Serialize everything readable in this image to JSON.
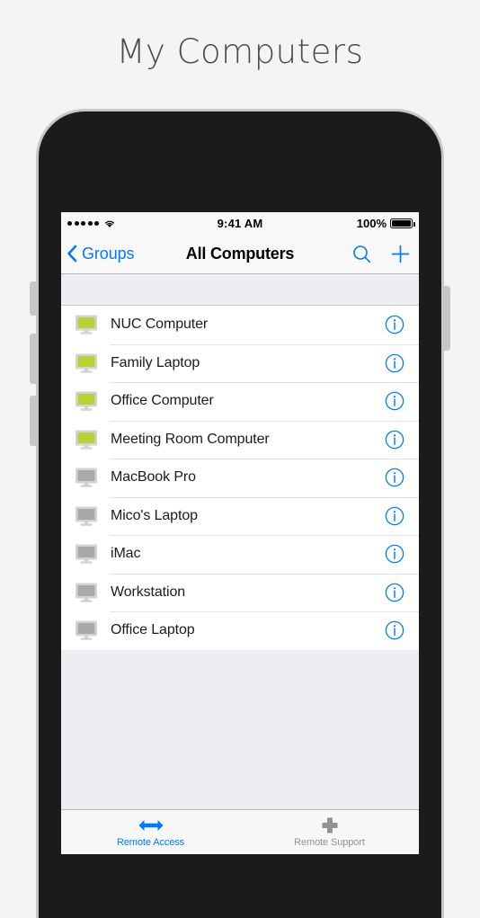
{
  "page": {
    "title": "My Computers"
  },
  "device": {
    "frame_color": "#c7c7c9",
    "body_color": "#1b1b1b"
  },
  "status_bar": {
    "signal_dots": 5,
    "wifi_icon": "wifi-icon",
    "time": "9:41 AM",
    "battery_percent": "100%",
    "battery_icon": "battery-full-icon"
  },
  "nav_bar": {
    "back_label": "Groups",
    "back_icon": "chevron-left-icon",
    "title": "All Computers",
    "search_icon": "search-icon",
    "add_icon": "plus-icon",
    "tint_color": "#007aff"
  },
  "list": {
    "online_color": "#b5d334",
    "offline_color": "#9b9b9f",
    "items": [
      {
        "name": "NUC Computer",
        "status": "online",
        "icon": "monitor-icon",
        "info_icon": "info-circle-icon"
      },
      {
        "name": "Family Laptop",
        "status": "online",
        "icon": "monitor-icon",
        "info_icon": "info-circle-icon"
      },
      {
        "name": "Office Computer",
        "status": "online",
        "icon": "monitor-icon",
        "info_icon": "info-circle-icon"
      },
      {
        "name": "Meeting Room Computer",
        "status": "online",
        "icon": "monitor-icon",
        "info_icon": "info-circle-icon"
      },
      {
        "name": "MacBook Pro",
        "status": "offline",
        "icon": "monitor-icon",
        "info_icon": "info-circle-icon"
      },
      {
        "name": "Mico's Laptop",
        "status": "offline",
        "icon": "monitor-icon",
        "info_icon": "info-circle-icon"
      },
      {
        "name": "iMac",
        "status": "offline",
        "icon": "monitor-icon",
        "info_icon": "info-circle-icon"
      },
      {
        "name": "Workstation",
        "status": "offline",
        "icon": "monitor-icon",
        "info_icon": "info-circle-icon"
      },
      {
        "name": "Office Laptop",
        "status": "offline",
        "icon": "monitor-icon",
        "info_icon": "info-circle-icon"
      }
    ]
  },
  "tab_bar": {
    "tabs": [
      {
        "label": "Remote Access",
        "icon": "double-arrow-icon",
        "selected": true,
        "color": "#007aff"
      },
      {
        "label": "Remote Support",
        "icon": "plus-thick-icon",
        "selected": false,
        "color": "#929292"
      }
    ]
  }
}
